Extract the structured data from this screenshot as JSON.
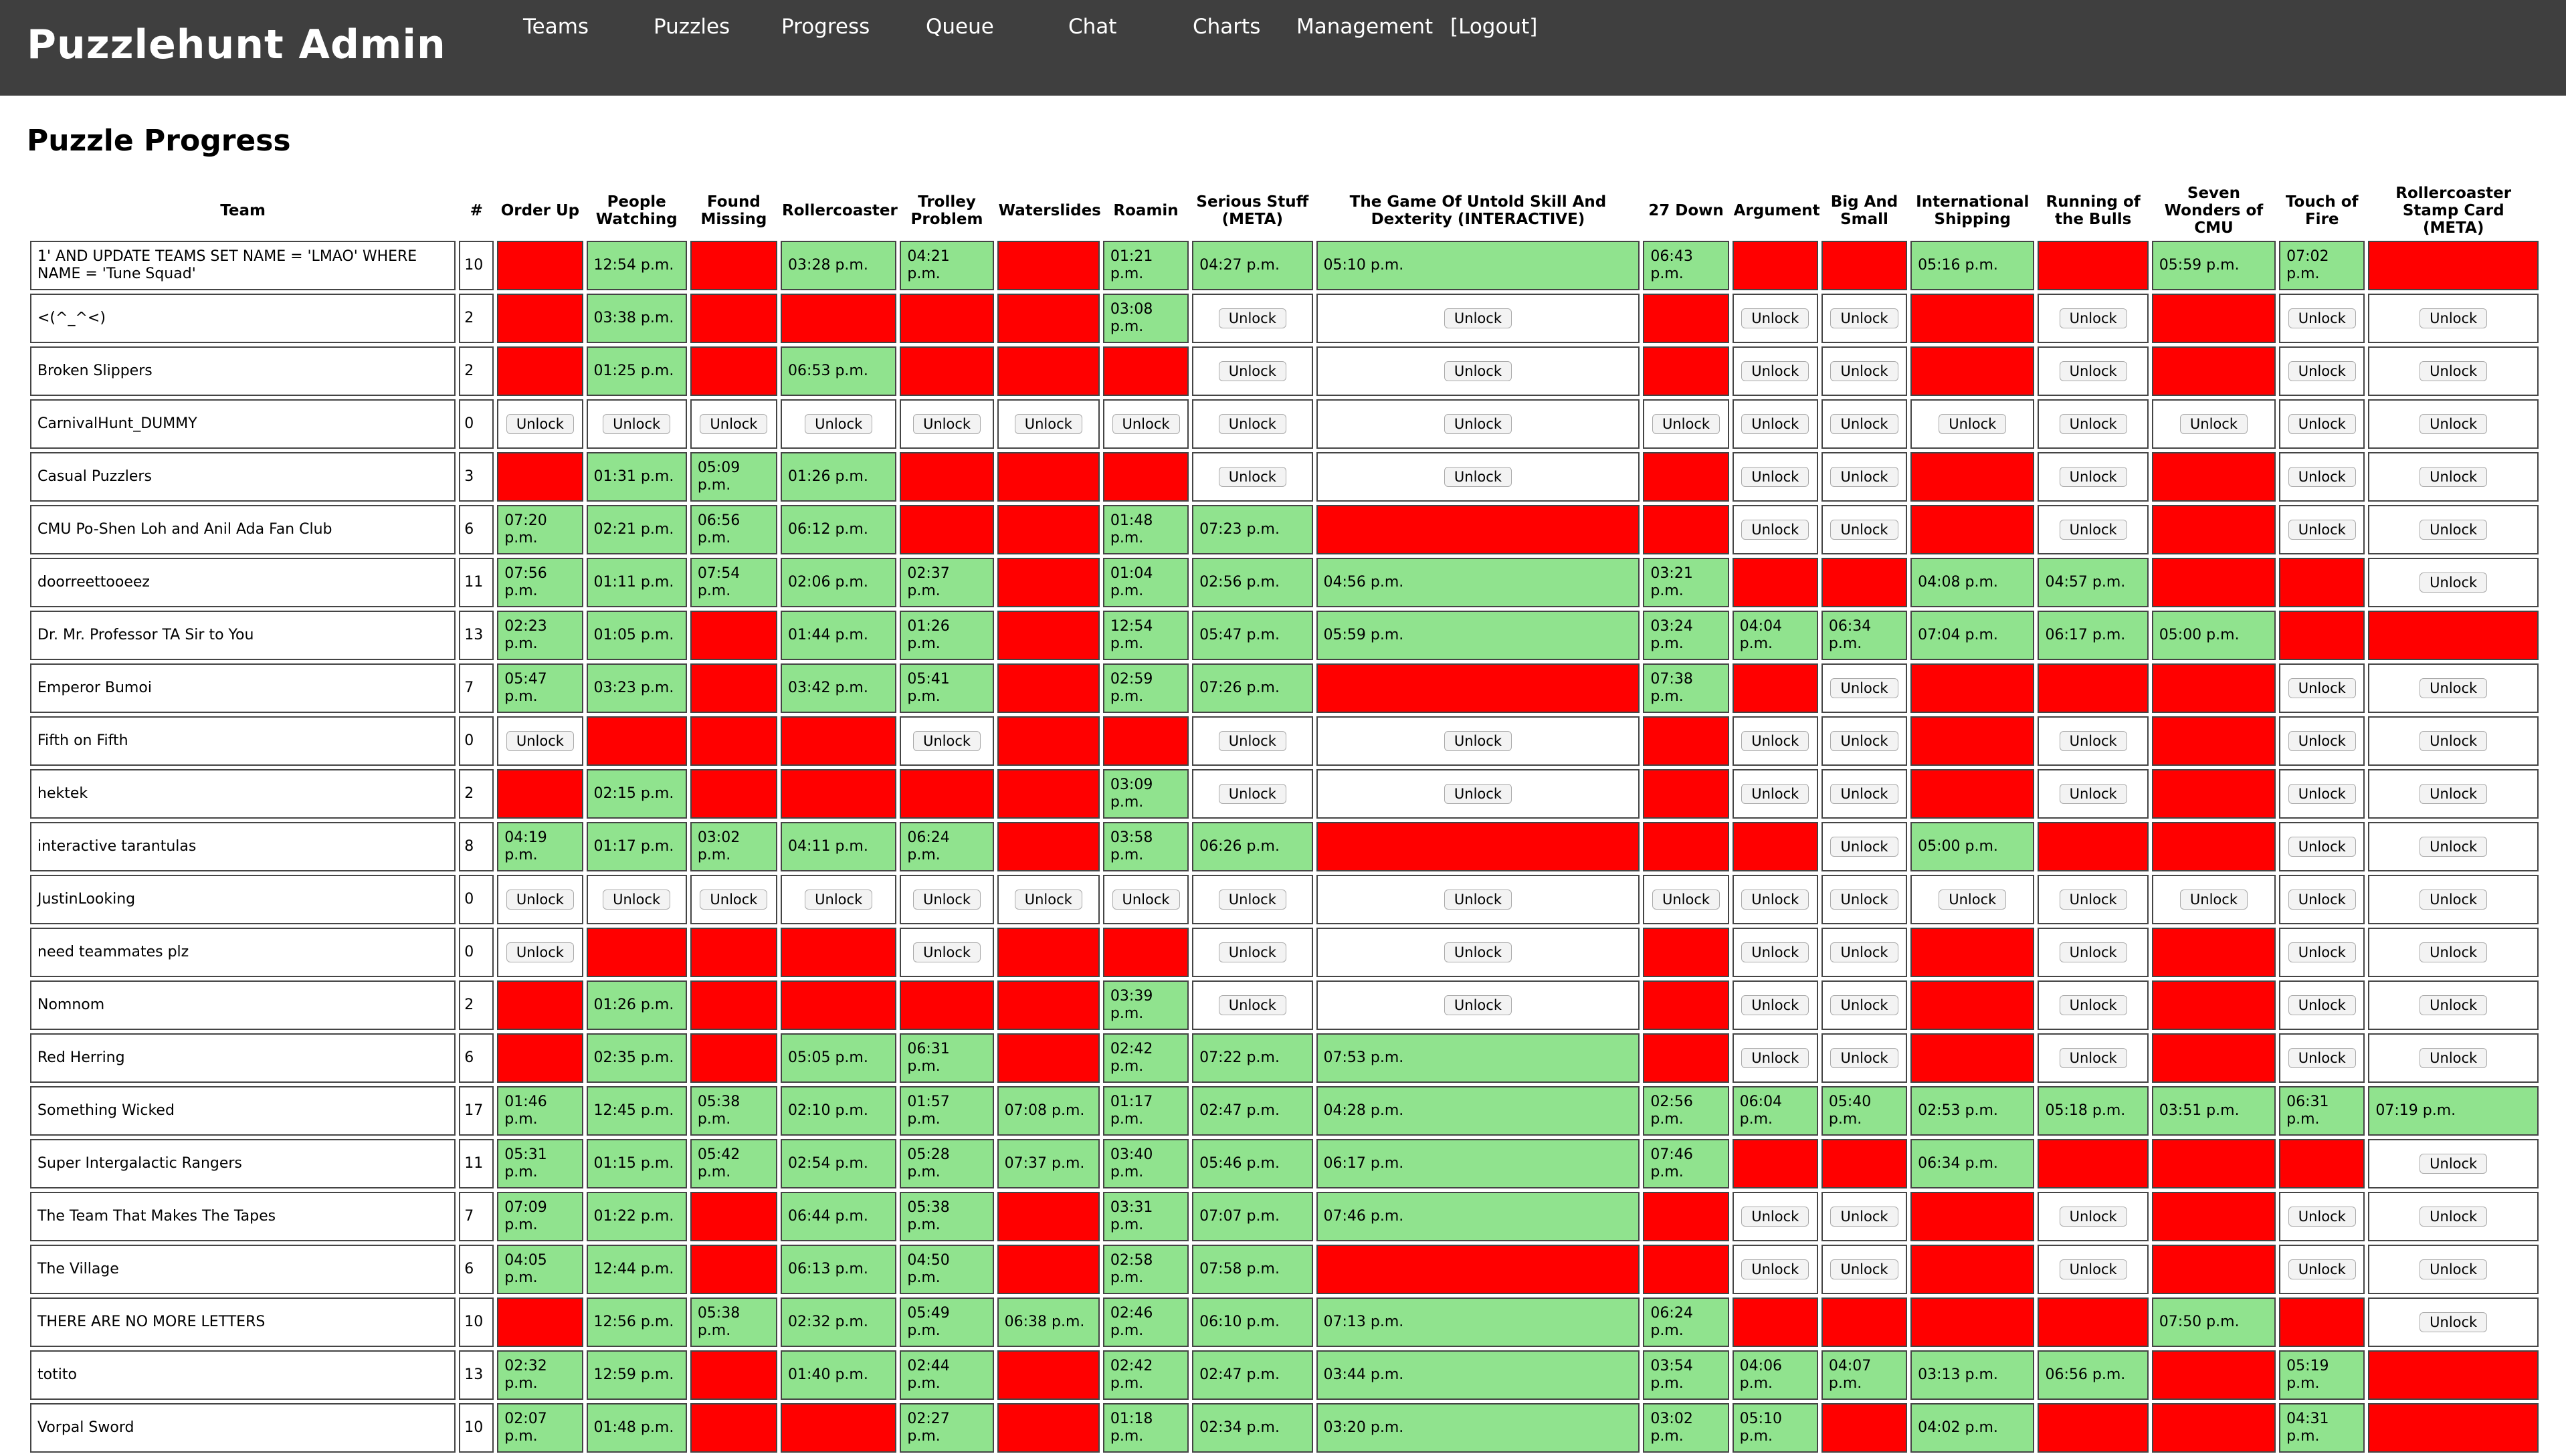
{
  "app": {
    "title": "Puzzlehunt Admin",
    "nav": [
      {
        "label": "Teams"
      },
      {
        "label": "Puzzles"
      },
      {
        "label": "Progress"
      },
      {
        "label": "Queue"
      },
      {
        "label": "Chat"
      },
      {
        "label": "Charts"
      },
      {
        "label": "Management"
      },
      {
        "label": "[Logout]"
      }
    ]
  },
  "page": {
    "title": "Puzzle Progress"
  },
  "colors": {
    "solved": "#90e38e",
    "unsolved": "#ff0000",
    "header": "#3f3f3f"
  },
  "unlock_label": "Unlock",
  "table": {
    "headers": [
      "Team",
      "#",
      "Order Up",
      "People Watching",
      "Found Missing",
      "Rollercoaster",
      "Trolley Problem",
      "Waterslides",
      "Roamin",
      "Serious Stuff (META)",
      "The Game Of Untold Skill And Dexterity (INTERACTIVE)",
      "27 Down",
      "Argument",
      "Big And Small",
      "International Shipping",
      "Running of the Bulls",
      "Seven Wonders of CMU",
      "Touch of Fire",
      "Rollercoaster Stamp Card (META)"
    ],
    "rows": [
      {
        "team": "1' AND UPDATE TEAMS SET NAME = 'LMAO' WHERE NAME = 'Tune Squad'",
        "count": "10",
        "cells": [
          "R",
          "12:54 p.m.",
          "R",
          "03:28 p.m.",
          "04:21 p.m.",
          "R",
          "01:21 p.m.",
          "04:27 p.m.",
          "05:10 p.m.",
          "06:43 p.m.",
          "R",
          "R",
          "05:16 p.m.",
          "R",
          "05:59 p.m.",
          "07:02 p.m.",
          "R"
        ]
      },
      {
        "team": "<(^_^<)",
        "count": "2",
        "cells": [
          "R",
          "03:38 p.m.",
          "R",
          "R",
          "R",
          "R",
          "03:08 p.m.",
          "U",
          "U",
          "R",
          "U",
          "U",
          "R",
          "U",
          "R",
          "U",
          "U"
        ]
      },
      {
        "team": "Broken Slippers",
        "count": "2",
        "cells": [
          "R",
          "01:25 p.m.",
          "R",
          "06:53 p.m.",
          "R",
          "R",
          "R",
          "U",
          "U",
          "R",
          "U",
          "U",
          "R",
          "U",
          "R",
          "U",
          "U"
        ]
      },
      {
        "team": "CarnivalHunt_DUMMY",
        "count": "0",
        "cells": [
          "U",
          "U",
          "U",
          "U",
          "U",
          "U",
          "U",
          "U",
          "U",
          "U",
          "U",
          "U",
          "U",
          "U",
          "U",
          "U",
          "U"
        ]
      },
      {
        "team": "Casual Puzzlers",
        "count": "3",
        "cells": [
          "R",
          "01:31 p.m.",
          "05:09 p.m.",
          "01:26 p.m.",
          "R",
          "R",
          "R",
          "U",
          "U",
          "R",
          "U",
          "U",
          "R",
          "U",
          "R",
          "U",
          "U"
        ]
      },
      {
        "team": "CMU Po-Shen Loh and Anil Ada Fan Club",
        "count": "6",
        "cells": [
          "07:20 p.m.",
          "02:21 p.m.",
          "06:56 p.m.",
          "06:12 p.m.",
          "R",
          "R",
          "01:48 p.m.",
          "07:23 p.m.",
          "R",
          "R",
          "U",
          "U",
          "R",
          "U",
          "R",
          "U",
          "U"
        ]
      },
      {
        "team": "doorreettooeez",
        "count": "11",
        "cells": [
          "07:56 p.m.",
          "01:11 p.m.",
          "07:54 p.m.",
          "02:06 p.m.",
          "02:37 p.m.",
          "R",
          "01:04 p.m.",
          "02:56 p.m.",
          "04:56 p.m.",
          "03:21 p.m.",
          "R",
          "R",
          "04:08 p.m.",
          "04:57 p.m.",
          "R",
          "R",
          "U"
        ]
      },
      {
        "team": "Dr. Mr. Professor TA Sir to You",
        "count": "13",
        "cells": [
          "02:23 p.m.",
          "01:05 p.m.",
          "R",
          "01:44 p.m.",
          "01:26 p.m.",
          "R",
          "12:54 p.m.",
          "05:47 p.m.",
          "05:59 p.m.",
          "03:24 p.m.",
          "04:04 p.m.",
          "06:34 p.m.",
          "07:04 p.m.",
          "06:17 p.m.",
          "05:00 p.m.",
          "R",
          "R"
        ]
      },
      {
        "team": "Emperor Bumoi",
        "count": "7",
        "cells": [
          "05:47 p.m.",
          "03:23 p.m.",
          "R",
          "03:42 p.m.",
          "05:41 p.m.",
          "R",
          "02:59 p.m.",
          "07:26 p.m.",
          "R",
          "07:38 p.m.",
          "R",
          "U",
          "R",
          "R",
          "R",
          "U",
          "U"
        ]
      },
      {
        "team": "Fifth on Fifth",
        "count": "0",
        "cells": [
          "U",
          "R",
          "R",
          "R",
          "U",
          "R",
          "R",
          "U",
          "U",
          "R",
          "U",
          "U",
          "R",
          "U",
          "R",
          "U",
          "U"
        ]
      },
      {
        "team": "hektek",
        "count": "2",
        "cells": [
          "R",
          "02:15 p.m.",
          "R",
          "R",
          "R",
          "R",
          "03:09 p.m.",
          "U",
          "U",
          "R",
          "U",
          "U",
          "R",
          "U",
          "R",
          "U",
          "U"
        ]
      },
      {
        "team": "interactive tarantulas",
        "count": "8",
        "cells": [
          "04:19 p.m.",
          "01:17 p.m.",
          "03:02 p.m.",
          "04:11 p.m.",
          "06:24 p.m.",
          "R",
          "03:58 p.m.",
          "06:26 p.m.",
          "R",
          "R",
          "R",
          "U",
          "05:00 p.m.",
          "R",
          "R",
          "U",
          "U"
        ]
      },
      {
        "team": "JustinLooking",
        "count": "0",
        "cells": [
          "U",
          "U",
          "U",
          "U",
          "U",
          "U",
          "U",
          "U",
          "U",
          "U",
          "U",
          "U",
          "U",
          "U",
          "U",
          "U",
          "U"
        ]
      },
      {
        "team": "need teammates plz",
        "count": "0",
        "cells": [
          "U",
          "R",
          "R",
          "R",
          "U",
          "R",
          "R",
          "U",
          "U",
          "R",
          "U",
          "U",
          "R",
          "U",
          "R",
          "U",
          "U"
        ]
      },
      {
        "team": "Nomnom",
        "count": "2",
        "cells": [
          "R",
          "01:26 p.m.",
          "R",
          "R",
          "R",
          "R",
          "03:39 p.m.",
          "U",
          "U",
          "R",
          "U",
          "U",
          "R",
          "U",
          "R",
          "U",
          "U"
        ]
      },
      {
        "team": "Red Herring",
        "count": "6",
        "cells": [
          "R",
          "02:35 p.m.",
          "R",
          "05:05 p.m.",
          "06:31 p.m.",
          "R",
          "02:42 p.m.",
          "07:22 p.m.",
          "07:53 p.m.",
          "R",
          "U",
          "U",
          "R",
          "U",
          "R",
          "U",
          "U"
        ]
      },
      {
        "team": "Something Wicked",
        "count": "17",
        "cells": [
          "01:46 p.m.",
          "12:45 p.m.",
          "05:38 p.m.",
          "02:10 p.m.",
          "01:57 p.m.",
          "07:08 p.m.",
          "01:17 p.m.",
          "02:47 p.m.",
          "04:28 p.m.",
          "02:56 p.m.",
          "06:04 p.m.",
          "05:40 p.m.",
          "02:53 p.m.",
          "05:18 p.m.",
          "03:51 p.m.",
          "06:31 p.m.",
          "07:19 p.m."
        ]
      },
      {
        "team": "Super Intergalactic Rangers",
        "count": "11",
        "cells": [
          "05:31 p.m.",
          "01:15 p.m.",
          "05:42 p.m.",
          "02:54 p.m.",
          "05:28 p.m.",
          "07:37 p.m.",
          "03:40 p.m.",
          "05:46 p.m.",
          "06:17 p.m.",
          "07:46 p.m.",
          "R",
          "R",
          "06:34 p.m.",
          "R",
          "R",
          "R",
          "U"
        ]
      },
      {
        "team": "The Team That Makes The Tapes",
        "count": "7",
        "cells": [
          "07:09 p.m.",
          "01:22 p.m.",
          "R",
          "06:44 p.m.",
          "05:38 p.m.",
          "R",
          "03:31 p.m.",
          "07:07 p.m.",
          "07:46 p.m.",
          "R",
          "U",
          "U",
          "R",
          "U",
          "R",
          "U",
          "U"
        ]
      },
      {
        "team": "The Village",
        "count": "6",
        "cells": [
          "04:05 p.m.",
          "12:44 p.m.",
          "R",
          "06:13 p.m.",
          "04:50 p.m.",
          "R",
          "02:58 p.m.",
          "07:58 p.m.",
          "R",
          "R",
          "U",
          "U",
          "R",
          "U",
          "R",
          "U",
          "U"
        ]
      },
      {
        "team": "THERE ARE NO MORE LETTERS",
        "count": "10",
        "cells": [
          "R",
          "12:56 p.m.",
          "05:38 p.m.",
          "02:32 p.m.",
          "05:49 p.m.",
          "06:38 p.m.",
          "02:46 p.m.",
          "06:10 p.m.",
          "07:13 p.m.",
          "06:24 p.m.",
          "R",
          "R",
          "R",
          "R",
          "07:50 p.m.",
          "R",
          "U"
        ]
      },
      {
        "team": "totito",
        "count": "13",
        "cells": [
          "02:32 p.m.",
          "12:59 p.m.",
          "R",
          "01:40 p.m.",
          "02:44 p.m.",
          "R",
          "02:42 p.m.",
          "02:47 p.m.",
          "03:44 p.m.",
          "03:54 p.m.",
          "04:06 p.m.",
          "04:07 p.m.",
          "03:13 p.m.",
          "06:56 p.m.",
          "R",
          "05:19 p.m.",
          "R"
        ]
      },
      {
        "team": "Vorpal Sword",
        "count": "10",
        "cells": [
          "02:07 p.m.",
          "01:48 p.m.",
          "R",
          "R",
          "02:27 p.m.",
          "R",
          "01:18 p.m.",
          "02:34 p.m.",
          "03:20 p.m.",
          "03:02 p.m.",
          "05:10 p.m.",
          "R",
          "04:02 p.m.",
          "R",
          "R",
          "04:31 p.m.",
          "R"
        ]
      }
    ]
  }
}
